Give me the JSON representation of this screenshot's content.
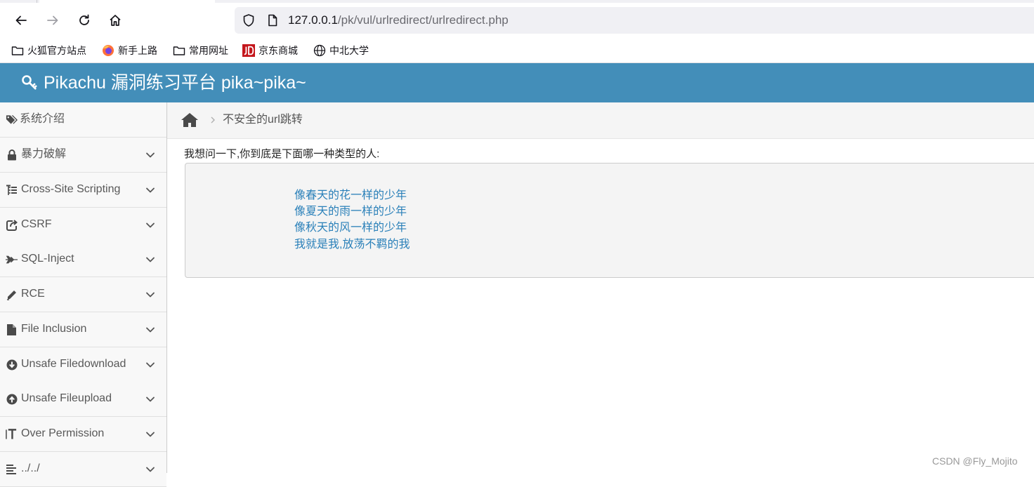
{
  "browser": {
    "url_host": "127.0.0.1",
    "url_path": "/pk/vul/urlredirect/urlredirect.php",
    "bookmarks": [
      {
        "label": "火狐官方站点",
        "icon": "folder-icon"
      },
      {
        "label": "新手上路",
        "icon": "firefox-icon"
      },
      {
        "label": "常用网址",
        "icon": "folder-icon"
      },
      {
        "label": "京东商城",
        "icon": "jd-icon"
      },
      {
        "label": "中北大学",
        "icon": "globe-icon"
      }
    ]
  },
  "app": {
    "title": "Pikachu 漏洞练习平台 pika~pika~",
    "header_color": "#438eb9"
  },
  "sidebar": {
    "items": [
      {
        "label": "系统介绍",
        "icon": "tags-icon",
        "expandable": false
      },
      {
        "label": "暴力破解",
        "icon": "lock-icon",
        "expandable": true
      },
      {
        "label": "Cross-Site Scripting",
        "icon": "list-tree-icon",
        "expandable": true
      },
      {
        "label": "CSRF",
        "icon": "share-icon",
        "expandable": true
      },
      {
        "label": "SQL-Inject",
        "icon": "plane-icon",
        "expandable": true
      },
      {
        "label": "RCE",
        "icon": "pencil-icon",
        "expandable": true
      },
      {
        "label": "File Inclusion",
        "icon": "file-icon",
        "expandable": true
      },
      {
        "label": "Unsafe Filedownload",
        "icon": "download-circle-icon",
        "expandable": true
      },
      {
        "label": "Unsafe Fileupload",
        "icon": "upload-circle-icon",
        "expandable": true
      },
      {
        "label": "Over Permission",
        "icon": "text-height-icon",
        "expandable": true
      },
      {
        "label": "../../",
        "icon": "align-left-icon",
        "expandable": true
      }
    ]
  },
  "breadcrumb": {
    "current": "不安全的url跳转"
  },
  "main": {
    "question": "我想问一下,你到底是下面哪一种类型的人:",
    "options": [
      "像春天的花一样的少年",
      "像夏天的雨一样的少年",
      "像秋天的风一样的少年",
      "我就是我,放荡不羁的我"
    ],
    "link_color": "#2a80b9"
  },
  "watermark": "CSDN @Fly_Mojito"
}
